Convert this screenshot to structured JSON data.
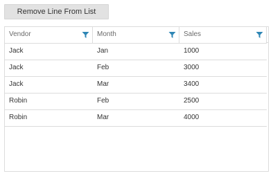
{
  "toolbar": {
    "remove_label": "Remove Line From List"
  },
  "grid": {
    "columns": [
      {
        "label": "Vendor",
        "icon": "filter-icon"
      },
      {
        "label": "Month",
        "icon": "filter-icon"
      },
      {
        "label": "Sales",
        "icon": "filter-icon"
      }
    ],
    "rows": [
      [
        "Jack",
        "Jan",
        "1000"
      ],
      [
        "Jack",
        "Feb",
        "3000"
      ],
      [
        "Jack",
        "Mar",
        "3400"
      ],
      [
        "Robin",
        "Feb",
        "2500"
      ],
      [
        "Robin",
        "Mar",
        "4000"
      ]
    ]
  },
  "colors": {
    "filter_icon": "#2f86b5",
    "button_bg": "#e2e2e2",
    "border": "#dcdcdc"
  }
}
